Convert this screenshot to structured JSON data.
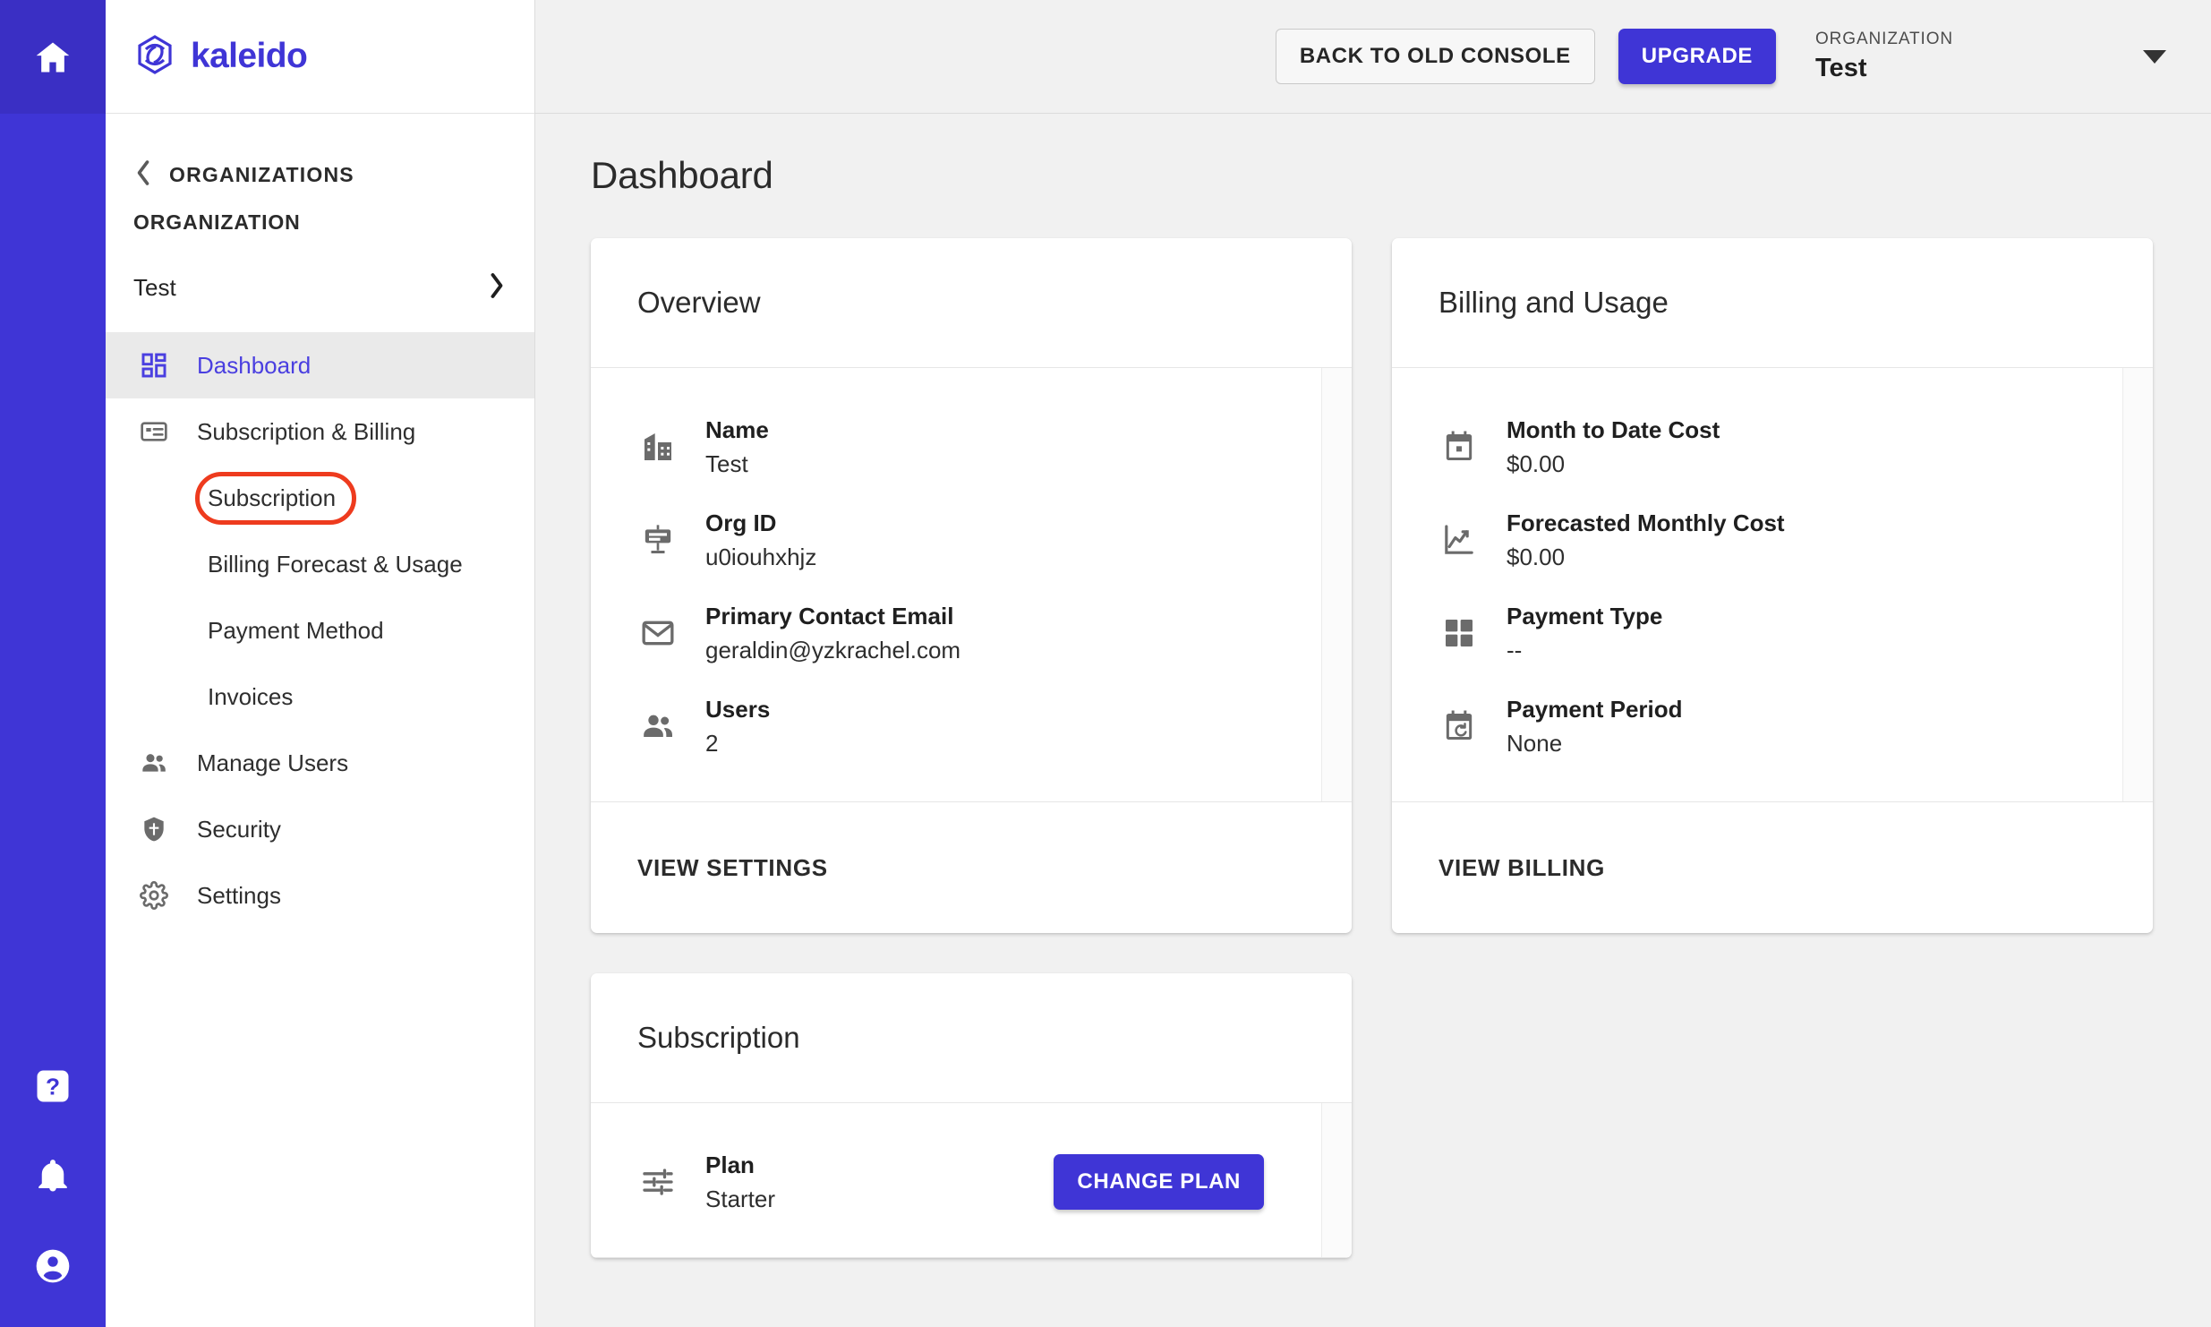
{
  "rail": {
    "home_icon": "home-icon",
    "help_icon": "help-icon",
    "notifications_icon": "bell-icon",
    "account_icon": "account-circle-icon"
  },
  "sidebar": {
    "brand_name": "kaleido",
    "brand_icon": "kaleido-logo-icon",
    "back_label": "ORGANIZATIONS",
    "back_icon": "chevron-left-icon",
    "section_label": "ORGANIZATION",
    "org_name": "Test",
    "org_chevron_icon": "chevron-right-icon",
    "items": [
      {
        "label": "Dashboard",
        "icon": "dashboard-grid-icon",
        "active": true
      },
      {
        "label": "Subscription & Billing",
        "icon": "card-icon",
        "active": false
      },
      {
        "label": "Manage Users",
        "icon": "people-icon",
        "active": false
      },
      {
        "label": "Security",
        "icon": "shield-icon",
        "active": false
      },
      {
        "label": "Settings",
        "icon": "gear-icon",
        "active": false
      }
    ],
    "sub_items": [
      {
        "label": "Subscription",
        "highlighted": true
      },
      {
        "label": "Billing Forecast & Usage",
        "highlighted": false
      },
      {
        "label": "Payment Method",
        "highlighted": false
      },
      {
        "label": "Invoices",
        "highlighted": false
      }
    ],
    "highlight_color": "#ee3b1e"
  },
  "topbar": {
    "back_console_label": "BACK TO OLD CONSOLE",
    "upgrade_label": "UPGRADE",
    "org_switch_label": "ORGANIZATION",
    "org_switch_value": "Test",
    "caret_icon": "caret-down-icon"
  },
  "page": {
    "title": "Dashboard",
    "accent_color": "#3f35d6"
  },
  "overview_card": {
    "title": "Overview",
    "fields": [
      {
        "icon": "building-icon",
        "label": "Name",
        "value": "Test"
      },
      {
        "icon": "org-id-icon",
        "label": "Org ID",
        "value": "u0iouhxhjz"
      },
      {
        "icon": "mail-icon",
        "label": "Primary Contact Email",
        "value": "geraldin@yzkrachel.com"
      },
      {
        "icon": "people-icon",
        "label": "Users",
        "value": "2"
      }
    ],
    "footer_link": "VIEW SETTINGS"
  },
  "billing_card": {
    "title": "Billing and Usage",
    "fields": [
      {
        "icon": "calendar-icon",
        "label": "Month to Date Cost",
        "value": "$0.00"
      },
      {
        "icon": "line-chart-icon",
        "label": "Forecasted Monthly Cost",
        "value": "$0.00"
      },
      {
        "icon": "grid-squares-icon",
        "label": "Payment Type",
        "value": "--"
      },
      {
        "icon": "calendar-repeat-icon",
        "label": "Payment Period",
        "value": "None"
      }
    ],
    "footer_link": "VIEW BILLING"
  },
  "subscription_card": {
    "title": "Subscription",
    "fields": [
      {
        "icon": "sliders-icon",
        "label": "Plan",
        "value": "Starter"
      }
    ],
    "change_plan_label": "CHANGE PLAN"
  }
}
